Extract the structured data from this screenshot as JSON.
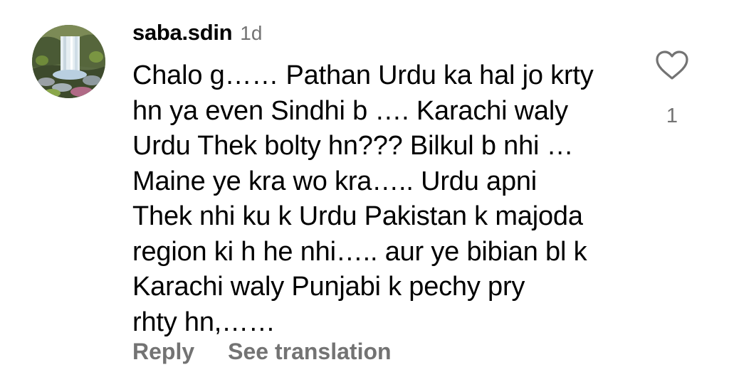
{
  "comment": {
    "username": "saba.sdin",
    "timestamp": "1d",
    "avatar_icon": "waterfall-photo",
    "text_lines": [
      "Chalo g…… Pathan Urdu ka hal jo krty",
      "hn ya even Sindhi b …. Karachi waly",
      "Urdu Thek bolty hn??? Bilkul b nhi …",
      "Maine ye kra wo kra….. Urdu apni",
      "Thek nhi ku k Urdu Pakistan k majoda",
      "region ki h he nhi….. aur ye bibian bl k",
      "Karachi waly Punjabi k pechy pry",
      "rhty hn,……"
    ],
    "like_icon": "heart-outline-icon",
    "like_count": "1",
    "actions": {
      "reply_label": "Reply",
      "translate_label": "See translation"
    }
  },
  "colors": {
    "text": "#000000",
    "secondary_text": "#737373",
    "background": "#ffffff"
  }
}
